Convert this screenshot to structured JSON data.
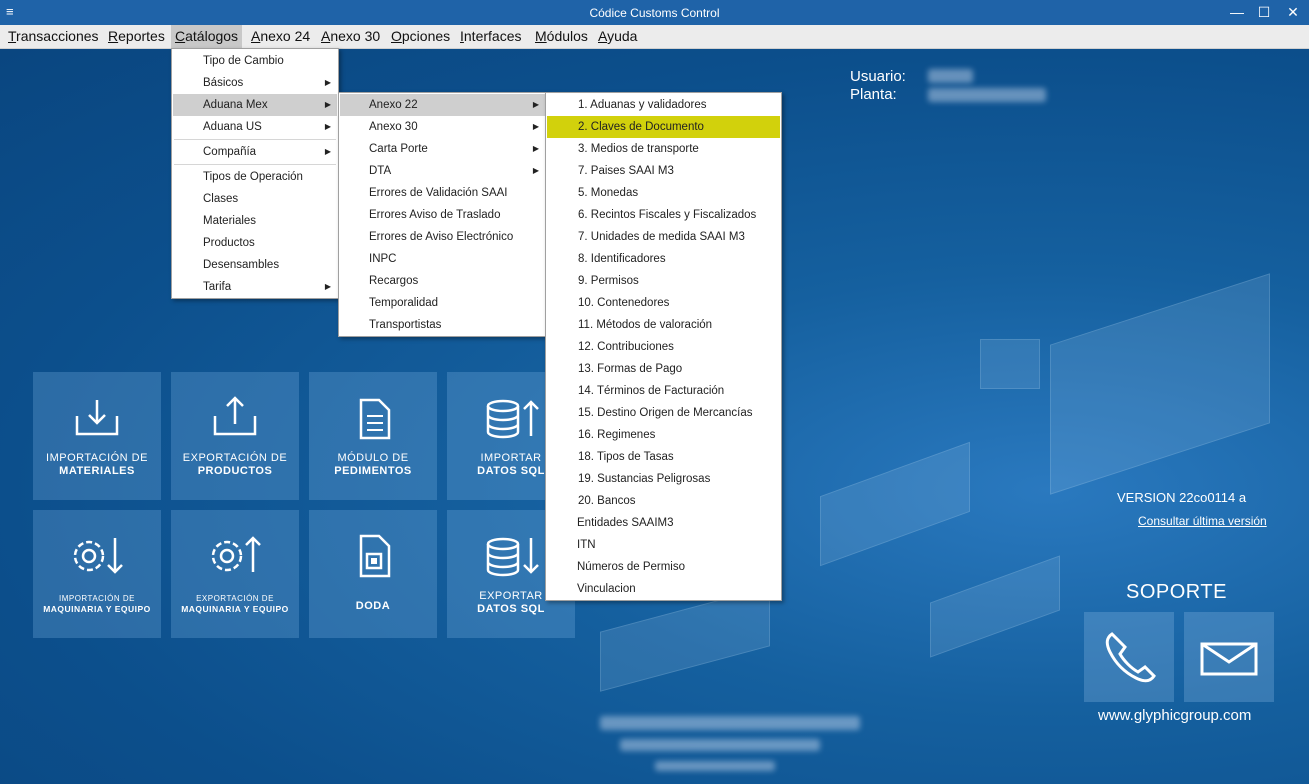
{
  "window": {
    "title": "Códice Customs Control",
    "sys_icon": "≡",
    "minimize": "—",
    "maximize": "☐",
    "close": "✕"
  },
  "menubar": [
    {
      "label": "Transacciones",
      "mn": "T",
      "rest": "ransacciones"
    },
    {
      "label": "Reportes",
      "mn": "R",
      "rest": "eportes"
    },
    {
      "label": "Catálogos",
      "mn": "C",
      "rest": "atálogos"
    },
    {
      "label": "Anexo 24",
      "mn": "A",
      "rest": "nexo 24"
    },
    {
      "label": "Anexo 30",
      "mn": "A",
      "rest": "nexo 30"
    },
    {
      "label": "Opciones",
      "mn": "O",
      "rest": "pciones"
    },
    {
      "label": "Interfaces",
      "mn": "I",
      "rest": "nterfaces"
    },
    {
      "label": "Módulos",
      "mn": "M",
      "rest": "ódulos"
    },
    {
      "label": "Ayuda",
      "mn": "A",
      "rest": "yuda"
    }
  ],
  "catalogos_menu": [
    "Tipo de Cambio",
    "Básicos",
    "Aduana Mex",
    "Aduana US",
    "Compañía",
    "Tipos de Operación",
    "Clases",
    "Materiales",
    "Productos",
    "Desensambles",
    "Tarifa"
  ],
  "aduana_mex_menu": [
    "Anexo 22",
    "Anexo 30",
    "Carta Porte",
    "DTA",
    "Errores de Validación SAAI",
    "Errores Aviso de Traslado",
    "Errores de Aviso Electrónico",
    "INPC",
    "Recargos",
    "Temporalidad",
    "Transportistas"
  ],
  "anexo22_menu": [
    "1. Aduanas y validadores",
    "2. Claves de Documento",
    "3. Medios de transporte",
    "7. Paises SAAI M3",
    "5. Monedas",
    "6. Recintos Fiscales y Fiscalizados",
    "7. Unidades de medida SAAI M3",
    "8. Identificadores",
    "9. Permisos",
    "10. Contenedores",
    "11. Métodos de valoración",
    "12. Contribuciones",
    "13. Formas de Pago",
    "14. Términos de Facturación",
    "15. Destino Origen de Mercancías",
    "16. Regimenes",
    "18. Tipos de Tasas",
    "19. Sustancias Peligrosas",
    "20. Bancos",
    "Entidades SAAIM3",
    "ITN",
    "Números de Permiso",
    "Vinculacion"
  ],
  "user": {
    "user_label": "Usuario:",
    "plant_label": "Planta:"
  },
  "tiles": [
    {
      "line1": "IMPORTACIÓN DE",
      "line2": "MATERIALES",
      "icon": "download-tray-icon"
    },
    {
      "line1": "EXPORTACIÓN DE",
      "line2": "PRODUCTOS",
      "icon": "upload-tray-icon"
    },
    {
      "line1": "MÓDULO DE",
      "line2": "PEDIMENTOS",
      "icon": "document-icon"
    },
    {
      "line1": "IMPORTAR",
      "line2": "DATOS SQL",
      "icon": "database-up-icon"
    },
    {
      "line1": "IMPORTACIÓN DE",
      "line2": "MAQUINARIA Y EQUIPO",
      "icon": "gear-down-icon"
    },
    {
      "line1": "EXPORTACIÓN DE",
      "line2": "MAQUINARIA Y EQUIPO",
      "icon": "gear-up-icon"
    },
    {
      "line1": "",
      "line2": "DODA",
      "icon": "doda-file-icon"
    },
    {
      "line1": "EXPORTAR",
      "line2": "DATOS SQL",
      "icon": "database-down-icon"
    }
  ],
  "version": "VERSION 22co0114 a",
  "consult_link": "Consultar última versión",
  "support": {
    "title": "SOPORTE",
    "website": "www.glyphicgroup.com"
  },
  "colors": {
    "accent_highlight": "#d2d10c",
    "titlebar": "#1f63a8",
    "background": "#0d4f8c"
  }
}
